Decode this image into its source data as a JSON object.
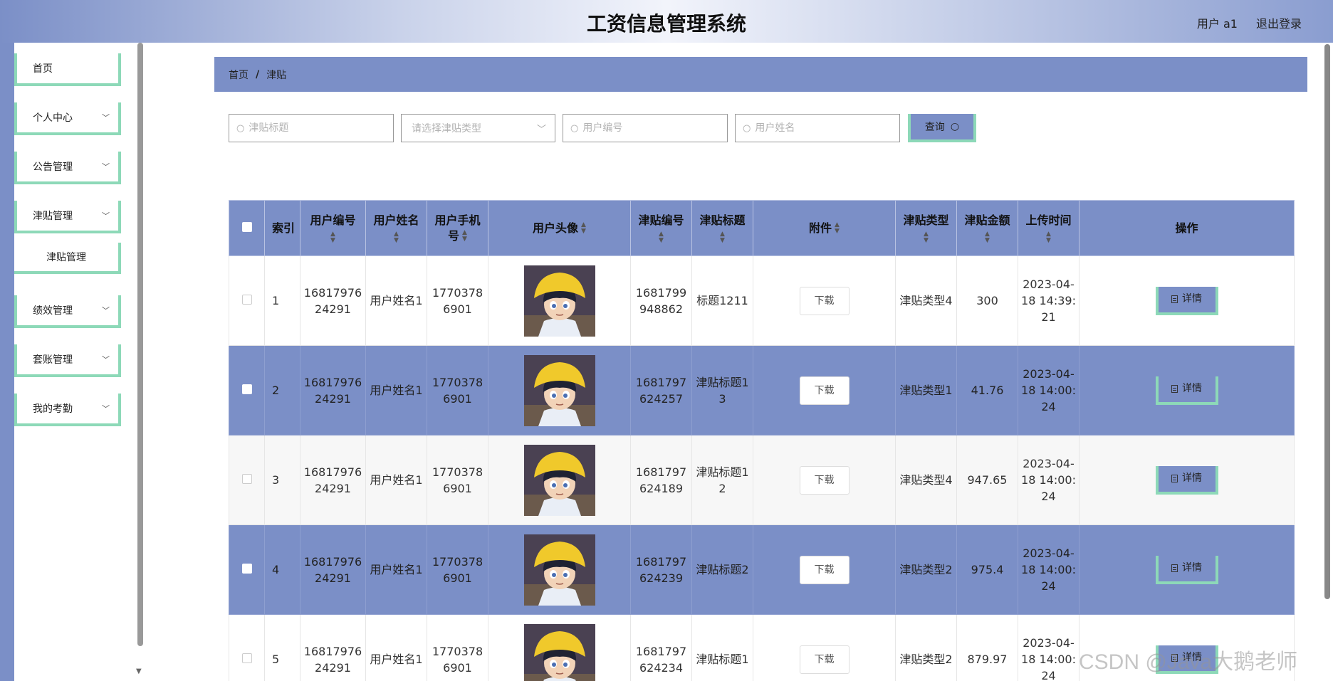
{
  "header": {
    "title": "工资信息管理系统",
    "user_label": "用户 a1",
    "logout_label": "退出登录"
  },
  "sidebar": {
    "items": [
      {
        "label": "首页",
        "has_chevron": false
      },
      {
        "label": "个人中心",
        "has_chevron": true
      },
      {
        "label": "公告管理",
        "has_chevron": true
      },
      {
        "label": "津贴管理",
        "has_chevron": true
      },
      {
        "label": "津贴管理",
        "is_sub": true
      },
      {
        "label": "绩效管理",
        "has_chevron": true
      },
      {
        "label": "套账管理",
        "has_chevron": true
      },
      {
        "label": "我的考勤",
        "has_chevron": true
      }
    ]
  },
  "breadcrumb": {
    "home": "首页",
    "separator": "/",
    "current": "津贴"
  },
  "search": {
    "title_placeholder": "津贴标题",
    "type_placeholder": "请选择津贴类型",
    "user_no_placeholder": "用户编号",
    "user_name_placeholder": "用户姓名",
    "query_label": "查询"
  },
  "table": {
    "headers": {
      "index": "索引",
      "user_no": "用户编号",
      "user_name": "用户姓名",
      "user_phone": "用户手机号",
      "avatar": "用户头像",
      "allowance_no": "津贴编号",
      "allowance_title": "津贴标题",
      "attachment": "附件",
      "allowance_type": "津贴类型",
      "amount": "津贴金额",
      "upload_time": "上传时间",
      "actions": "操作"
    },
    "download_label": "下载",
    "detail_label": "详情",
    "rows": [
      {
        "index": "1",
        "user_no": "1681797624291",
        "user_name": "用户姓名1",
        "phone": "17703786901",
        "no": "1681799948862",
        "title": "标题1211",
        "type": "津贴类型4",
        "amount": "300",
        "time": "2023-04-18 14:39:21"
      },
      {
        "index": "2",
        "user_no": "1681797624291",
        "user_name": "用户姓名1",
        "phone": "17703786901",
        "no": "1681797624257",
        "title": "津贴标题13",
        "type": "津贴类型1",
        "amount": "41.76",
        "time": "2023-04-18 14:00:24"
      },
      {
        "index": "3",
        "user_no": "1681797624291",
        "user_name": "用户姓名1",
        "phone": "17703786901",
        "no": "1681797624189",
        "title": "津贴标题12",
        "type": "津贴类型4",
        "amount": "947.65",
        "time": "2023-04-18 14:00:24"
      },
      {
        "index": "4",
        "user_no": "1681797624291",
        "user_name": "用户姓名1",
        "phone": "17703786901",
        "no": "1681797624239",
        "title": "津贴标题2",
        "type": "津贴类型2",
        "amount": "975.4",
        "time": "2023-04-18 14:00:24"
      },
      {
        "index": "5",
        "user_no": "1681797624291",
        "user_name": "用户姓名1",
        "phone": "17703786901",
        "no": "1681797624234",
        "title": "津贴标题1",
        "type": "津贴类型2",
        "amount": "879.97",
        "time": "2023-04-18 14:00:24"
      }
    ]
  },
  "watermark": "CSDN @Java大鹅老师",
  "colors": {
    "primary": "#7b8fc7",
    "accent": "#8dd9b8"
  }
}
